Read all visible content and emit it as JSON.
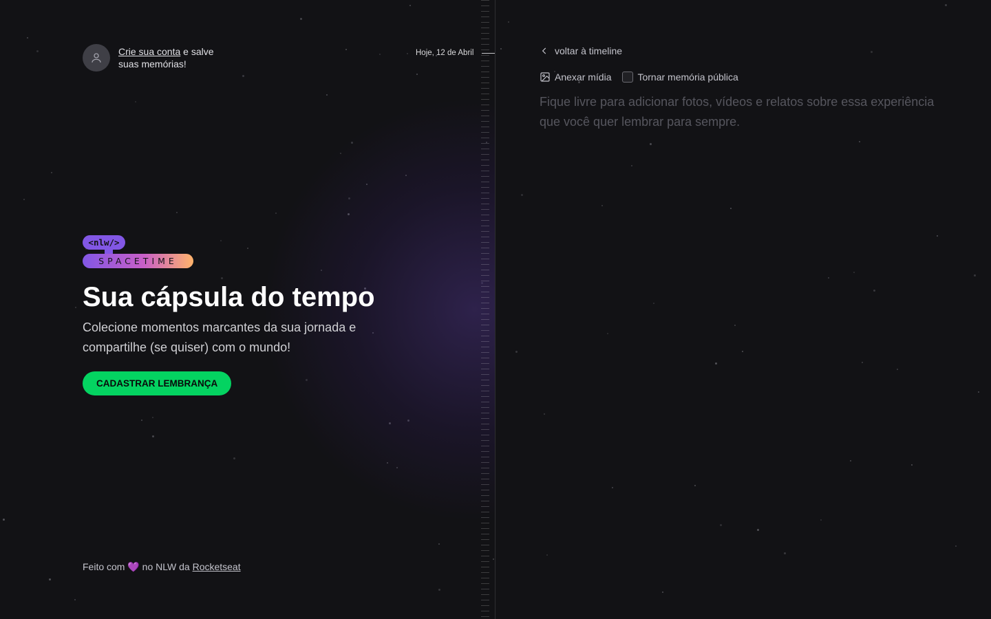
{
  "header": {
    "signin_link": "Crie sua conta",
    "signin_rest_1": " e salve",
    "signin_rest_2": "suas memórias!",
    "date_label": "Hoje, 12 de Abril"
  },
  "logo": {
    "tag": "<nlw/>",
    "brand": "SPACETIME",
    "colors": {
      "purple": "#8257e5",
      "pink": "#ff5d9e",
      "orange": "#ffb36b"
    }
  },
  "hero": {
    "title": "Sua cápsula do tempo",
    "description": "Colecione momentos marcantes da sua jornada e compartilhe (se quiser) com o mundo!",
    "cta_label": "CADASTRAR LEMBRANÇA",
    "cta_color": "#04d361"
  },
  "footer": {
    "prefix": "Feito com ",
    "heart": "💜",
    "middle": " no NLW da ",
    "link": "Rocketseat"
  },
  "editor": {
    "back_label": "voltar à timeline",
    "attach_label": "Anexar mídia",
    "public_label": "Tornar memória pública",
    "placeholder": "Fique livre para adicionar fotos, vídeos e relatos sobre essa experiência que você quer lembrar para sempre."
  },
  "icons": {
    "user": "user-icon",
    "back": "chevron-left-icon",
    "media": "image-icon",
    "checkbox": "checkbox-icon"
  }
}
